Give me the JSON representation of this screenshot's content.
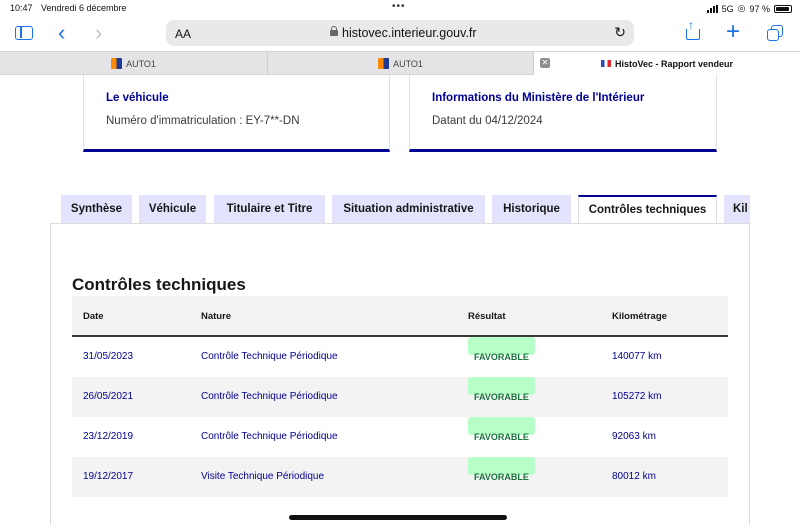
{
  "status_bar": {
    "time": "10:47",
    "date": "Vendredi 6 décembre",
    "network": "5G",
    "battery": "97 %"
  },
  "browser": {
    "text_size_label": "AA",
    "url": "histovec.interieur.gouv.fr",
    "tabs": [
      {
        "label": "AUTO1"
      },
      {
        "label": "AUTO1"
      },
      {
        "label": "HistoVec - Rapport vendeur"
      }
    ]
  },
  "cards": {
    "vehicle": {
      "title": "Le véhicule",
      "text": "Numéro d'immatriculation : EY-7**-DN"
    },
    "ministry": {
      "title": "Informations du Ministère de l'Intérieur",
      "text": "Datant du 04/12/2024"
    }
  },
  "page_tabs": [
    {
      "label": "Synthèse"
    },
    {
      "label": "Véhicule"
    },
    {
      "label": "Titulaire et Titre"
    },
    {
      "label": "Situation administrative"
    },
    {
      "label": "Historique"
    },
    {
      "label": "Contrôles techniques"
    },
    {
      "label": "Kil"
    }
  ],
  "active_tab": "Contrôles techniques",
  "section": {
    "title": "Contrôles techniques",
    "columns": [
      "Date",
      "Nature",
      "Résultat",
      "Kilométrage"
    ],
    "rows": [
      {
        "date": "31/05/2023",
        "nature": "Contrôle Technique Périodique",
        "result": "FAVORABLE",
        "km": "140077 km"
      },
      {
        "date": "26/05/2021",
        "nature": "Contrôle Technique Périodique",
        "result": "FAVORABLE",
        "km": "105272 km"
      },
      {
        "date": "23/12/2019",
        "nature": "Contrôle Technique Périodique",
        "result": "FAVORABLE",
        "km": "92063 km"
      },
      {
        "date": "19/12/2017",
        "nature": "Visite Technique Périodique",
        "result": "FAVORABLE",
        "km": "80012 km"
      }
    ]
  },
  "colors": {
    "accent": "#000091",
    "tab_bg": "#e3e3fd",
    "badge_bg": "#b8fec9",
    "badge_text": "#18753c",
    "link": "#1a73e8"
  }
}
